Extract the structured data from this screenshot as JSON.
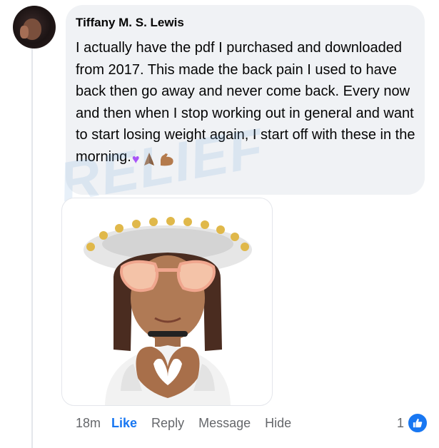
{
  "comment": {
    "author": "Tiffany M. S. Lewis",
    "text": "I actually have the pdf I purchased and downloaded from 2017. This made the back pain I used to have back then go away and never come back. Every now and then when I stop working out in general and want to start losing weight again, I start off with these in the morning.",
    "emojis": [
      "purple-heart",
      "folded-hands",
      "flexed-biceps"
    ]
  },
  "watermark": {
    "text": "RELIEF"
  },
  "actions": {
    "timestamp": "18m",
    "like": "Like",
    "reply": "Reply",
    "message": "Message",
    "hide": "Hide"
  },
  "reactions": {
    "count": "1",
    "icon": "thumbs-up-icon",
    "color": "#1877f2"
  }
}
